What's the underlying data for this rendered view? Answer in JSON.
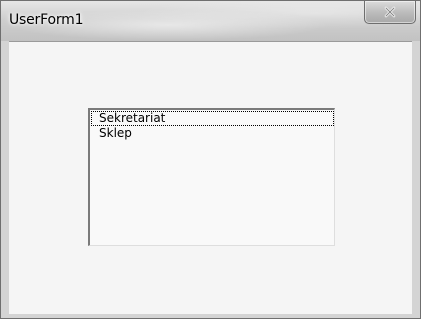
{
  "window": {
    "title": "UserForm1",
    "close_icon": "close-x-icon"
  },
  "listbox": {
    "items": [
      {
        "label": "Sekretariat",
        "focused": true
      },
      {
        "label": "Sklep",
        "focused": false
      }
    ]
  }
}
